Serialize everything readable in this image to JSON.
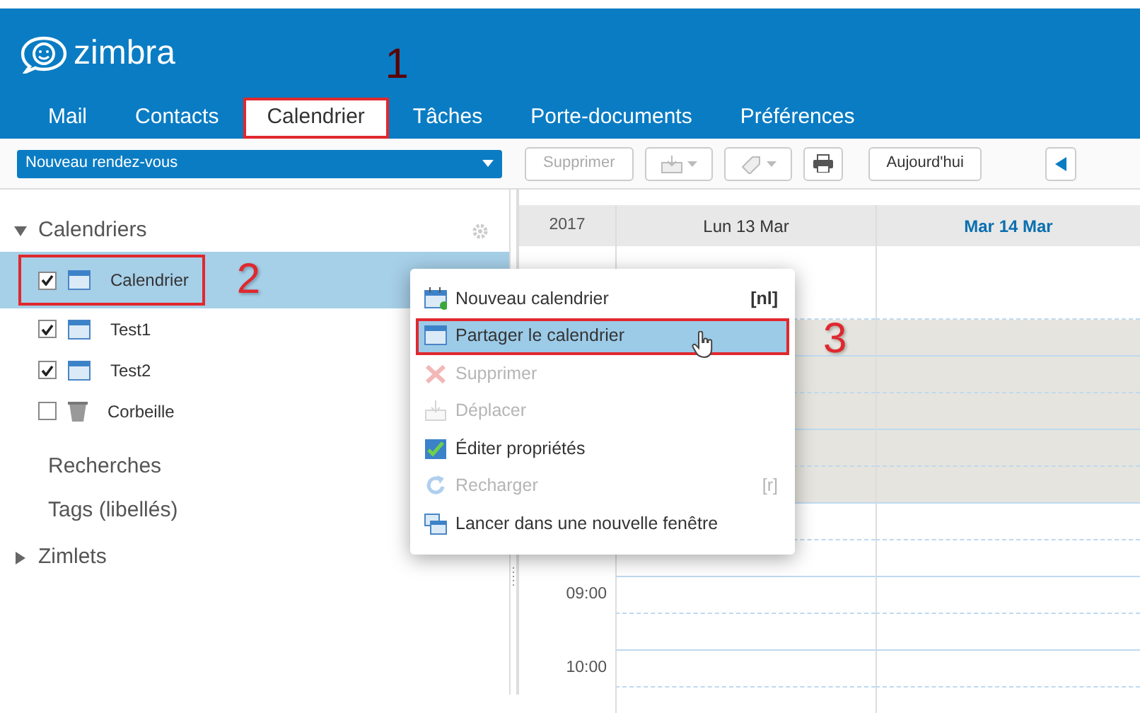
{
  "app": {
    "logo": "zimbra"
  },
  "tabs": [
    {
      "label": "Mail",
      "selected": false
    },
    {
      "label": "Contacts",
      "selected": false
    },
    {
      "label": "Calendrier",
      "selected": true,
      "callout": "1"
    },
    {
      "label": "Tâches",
      "selected": false
    },
    {
      "label": "Porte-documents",
      "selected": false
    },
    {
      "label": "Préférences",
      "selected": false
    }
  ],
  "toolbar": {
    "new_button": "Nouveau rendez-vous",
    "buttons": [
      {
        "kind": "text",
        "label": "Supprimer",
        "disabled": true
      },
      {
        "kind": "move",
        "disabled": true
      },
      {
        "kind": "tag",
        "disabled": true
      },
      {
        "kind": "print",
        "disabled": false
      },
      {
        "kind": "text",
        "label": "Aujourd'hui",
        "disabled": false
      },
      {
        "kind": "previous",
        "disabled": false
      }
    ]
  },
  "sidebar": {
    "calendars_header": {
      "label": "Calendriers",
      "expanded": true
    },
    "calendars": [
      {
        "label": "Calendrier",
        "kind": "calendar",
        "checked": true,
        "selected": true,
        "callout": "2"
      },
      {
        "label": "Test1",
        "kind": "calendar",
        "checked": true,
        "selected": false
      },
      {
        "label": "Test2",
        "kind": "calendar",
        "checked": true,
        "selected": false
      },
      {
        "label": "Corbeille",
        "kind": "trash",
        "checked": false,
        "selected": false
      }
    ],
    "searches": "Recherches",
    "tags": "Tags (libellés)",
    "zimlets": {
      "label": "Zimlets",
      "expanded": false
    }
  },
  "calendar": {
    "year": "2017",
    "days": [
      {
        "label": "Lun 13 Mar",
        "today": false
      },
      {
        "label": "Mar 14 Mar",
        "today": true
      }
    ],
    "slots": [
      {
        "off_hours": false
      },
      {
        "off_hours": true
      },
      {
        "off_hours": true
      },
      {
        "off_hours": true
      },
      {
        "off_hours": true
      },
      {
        "off_hours": true
      },
      {
        "off_hours": false
      },
      {
        "off_hours": false
      },
      {
        "off_hours": false,
        "label": "09:00"
      },
      {
        "off_hours": false
      },
      {
        "off_hours": false,
        "label": "10:00"
      },
      {
        "off_hours": false
      }
    ]
  },
  "context_menu": {
    "items": [
      {
        "label": "Nouveau calendrier",
        "shortcut": "[nl]",
        "disabled": false,
        "selected": false
      },
      {
        "label": "Partager le calendrier",
        "disabled": false,
        "selected": true,
        "callout": "3"
      },
      {
        "label": "Supprimer",
        "disabled": true,
        "selected": false
      },
      {
        "label": "Déplacer",
        "disabled": true,
        "selected": false
      },
      {
        "label": "Éditer propriétés",
        "disabled": false,
        "selected": false
      },
      {
        "label": "Recharger",
        "shortcut": "[r]",
        "disabled": true,
        "selected": false
      },
      {
        "label": "Lancer dans une nouvelle fenêtre",
        "disabled": false,
        "selected": false
      }
    ]
  }
}
